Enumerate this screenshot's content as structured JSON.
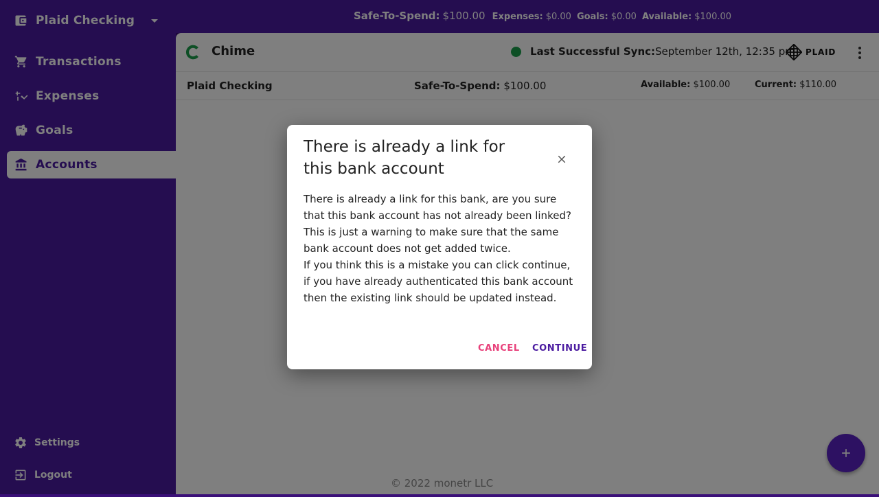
{
  "header": {
    "budget_name": "Plaid Checking",
    "summary": {
      "safe_to_spend_label": "Safe-To-Spend:",
      "safe_to_spend_value": "$100.00",
      "expenses_label": "Expenses:",
      "expenses_value": "$0.00",
      "goals_label": "Goals:",
      "goals_value": "$0.00",
      "available_label": "Available:",
      "available_value": "$100.00"
    }
  },
  "sidebar": {
    "items": [
      {
        "label": "Transactions",
        "icon": "cart-icon"
      },
      {
        "label": "Expenses",
        "icon": "expenses-icon"
      },
      {
        "label": "Goals",
        "icon": "piggy-bank-icon"
      },
      {
        "label": "Accounts",
        "icon": "bank-icon"
      }
    ],
    "bottom": [
      {
        "label": "Settings",
        "icon": "gear-icon"
      },
      {
        "label": "Logout",
        "icon": "logout-icon"
      }
    ]
  },
  "link": {
    "bank_name": "Chime",
    "sync_label": "Last Successful Sync:",
    "sync_value": "September 12th, 12:35 pm",
    "provider": "PLAID"
  },
  "account": {
    "name": "Plaid Checking",
    "safe_to_spend_label": "Safe-To-Spend:",
    "safe_to_spend_value": "$100.00",
    "available_label": "Available:",
    "available_value": "$100.00",
    "current_label": "Current:",
    "current_value": "$110.00"
  },
  "footer": {
    "copyright": "© 2022 monetr LLC"
  },
  "dialog": {
    "title": "There is already a link for this bank account",
    "body_p1": "There is already a link for this bank, are you sure that this bank account has not already been linked? This is just a warning to make sure that the same bank account does not get added twice.",
    "body_p2": "If you think this is a mistake you can click continue, if you have already authenticated this bank account then the existing link should be updated instead.",
    "cancel_label": "CANCEL",
    "continue_label": "CONTINUE"
  },
  "colors": {
    "primary": "#4a1aa0",
    "secondary": "#e8407a",
    "sync_ok": "#1a9e4b"
  }
}
